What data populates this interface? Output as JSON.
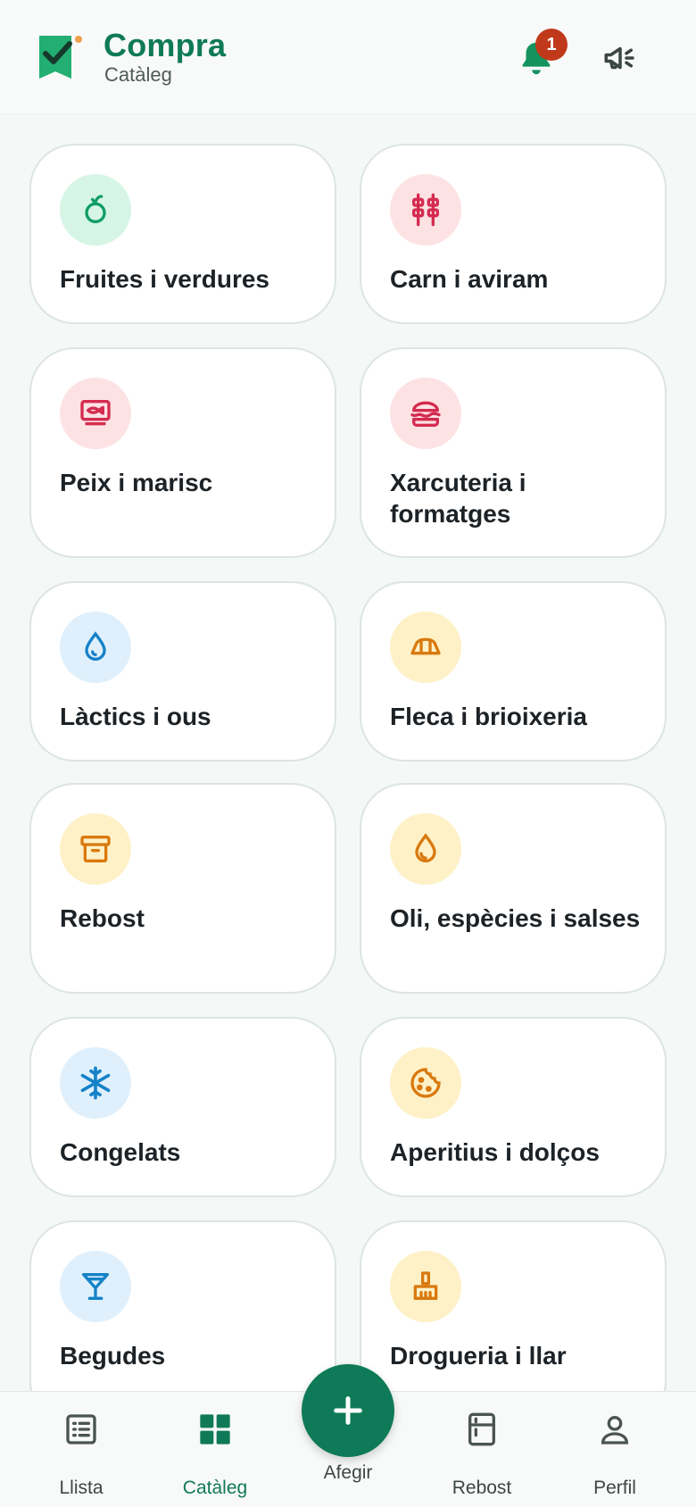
{
  "header": {
    "title": "Compra",
    "subtitle": "Catàleg",
    "notification_count": "1"
  },
  "categories": [
    {
      "label": "Fruites i verdures",
      "icon": "apple-icon",
      "tint": "#0f9e64"
    },
    {
      "label": "Carn i aviram",
      "icon": "meat-skewer-icon",
      "tint": "#d42b4f"
    },
    {
      "label": "Peix i marisc",
      "icon": "fish-icon",
      "tint": "#d42b4f"
    },
    {
      "label": "Xarcuteria i formatges",
      "icon": "sandwich-icon",
      "tint": "#d42b4f"
    },
    {
      "label": "Làctics i ous",
      "icon": "egg-drop-icon",
      "tint": "#1582c8"
    },
    {
      "label": "Fleca i brioixeria",
      "icon": "croissant-icon",
      "tint": "#d9790e"
    },
    {
      "label": "Rebost",
      "icon": "archive-box-icon",
      "tint": "#d9790e"
    },
    {
      "label": "Oli, espècies i salses",
      "icon": "oil-drop-icon",
      "tint": "#d9790e"
    },
    {
      "label": "Congelats",
      "icon": "snowflake-icon",
      "tint": "#1582c8"
    },
    {
      "label": "Aperitius i dolços",
      "icon": "cookie-icon",
      "tint": "#d9790e"
    },
    {
      "label": "Begudes",
      "icon": "cocktail-icon",
      "tint": "#1582c8"
    },
    {
      "label": "Drogueria i llar",
      "icon": "brush-icon",
      "tint": "#d9790e"
    }
  ],
  "nav": {
    "list": "Llista",
    "catalog": "Catàleg",
    "add": "Afegir",
    "pantry": "Rebost",
    "profile": "Perfil"
  },
  "colors": {
    "brand": "#0f7a57",
    "badge": "#c0391b"
  }
}
